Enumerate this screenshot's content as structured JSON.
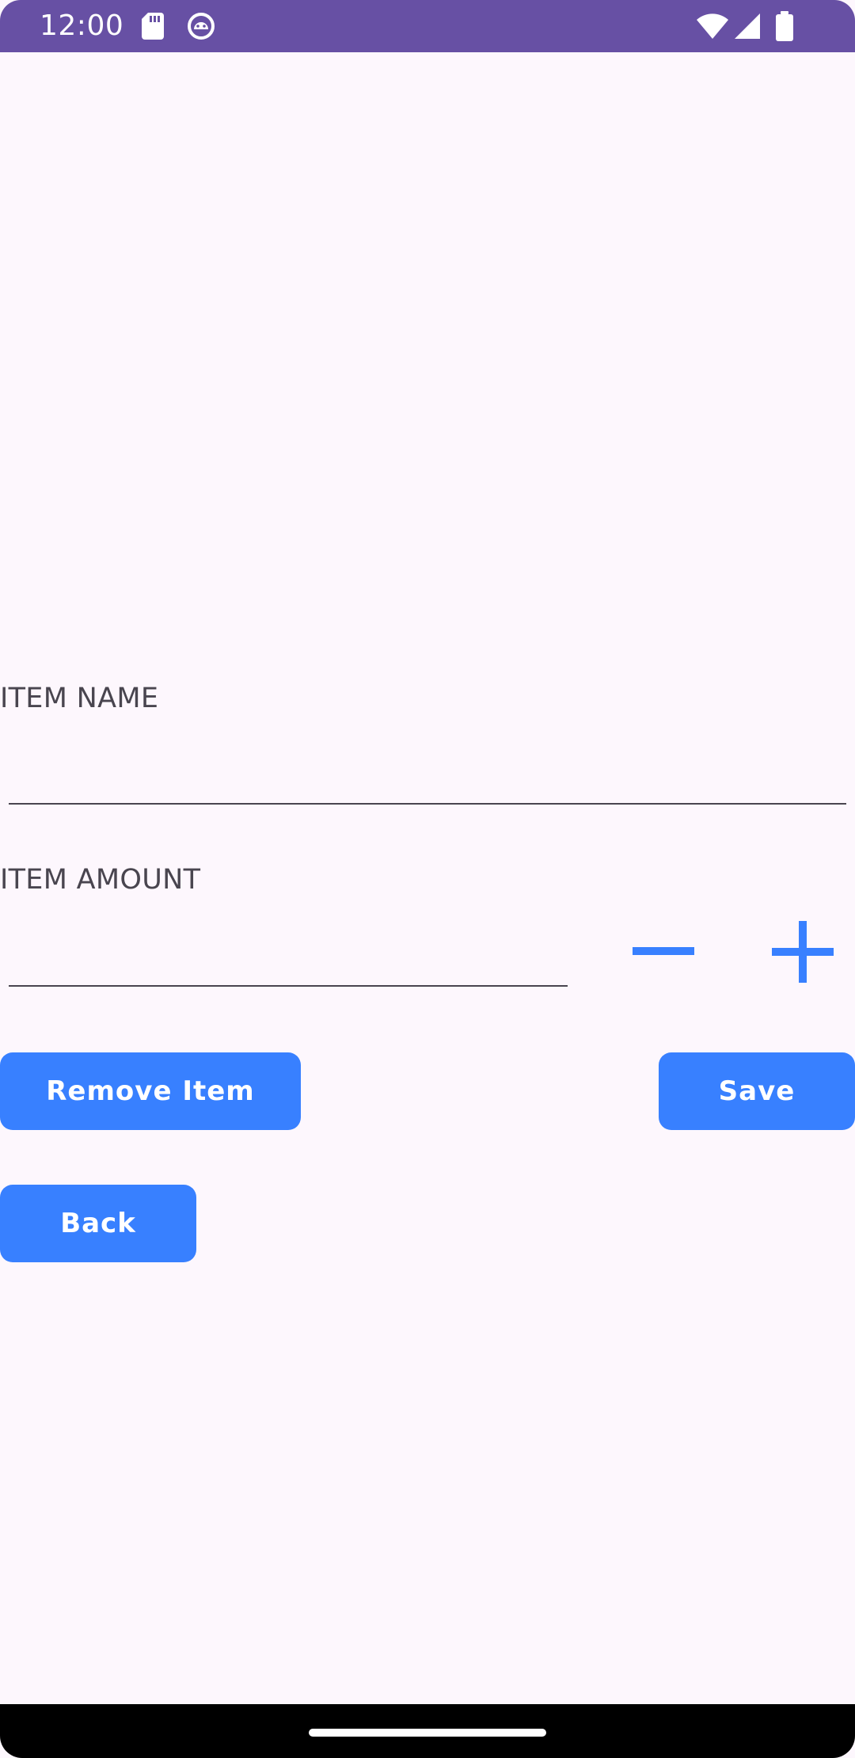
{
  "status_bar": {
    "time": "12:00",
    "background": "#6750a4",
    "left_icons": [
      "sd-card-icon",
      "android-debug-icon"
    ],
    "right_icons": [
      "wifi-icon",
      "signal-icon",
      "battery-icon"
    ]
  },
  "form": {
    "item_name": {
      "label": "ITEM NAME",
      "value": "",
      "placeholder": ""
    },
    "item_amount": {
      "label": "ITEM AMOUNT",
      "value": "",
      "placeholder": ""
    },
    "decrement_icon": "minus-icon",
    "increment_icon": "plus-icon"
  },
  "buttons": {
    "remove_label": "Remove Item",
    "save_label": "Save",
    "back_label": "Back",
    "color": "#3880ff"
  },
  "colors": {
    "background": "#fdf7fd",
    "accent": "#3880ff",
    "label_text": "#49454f"
  }
}
